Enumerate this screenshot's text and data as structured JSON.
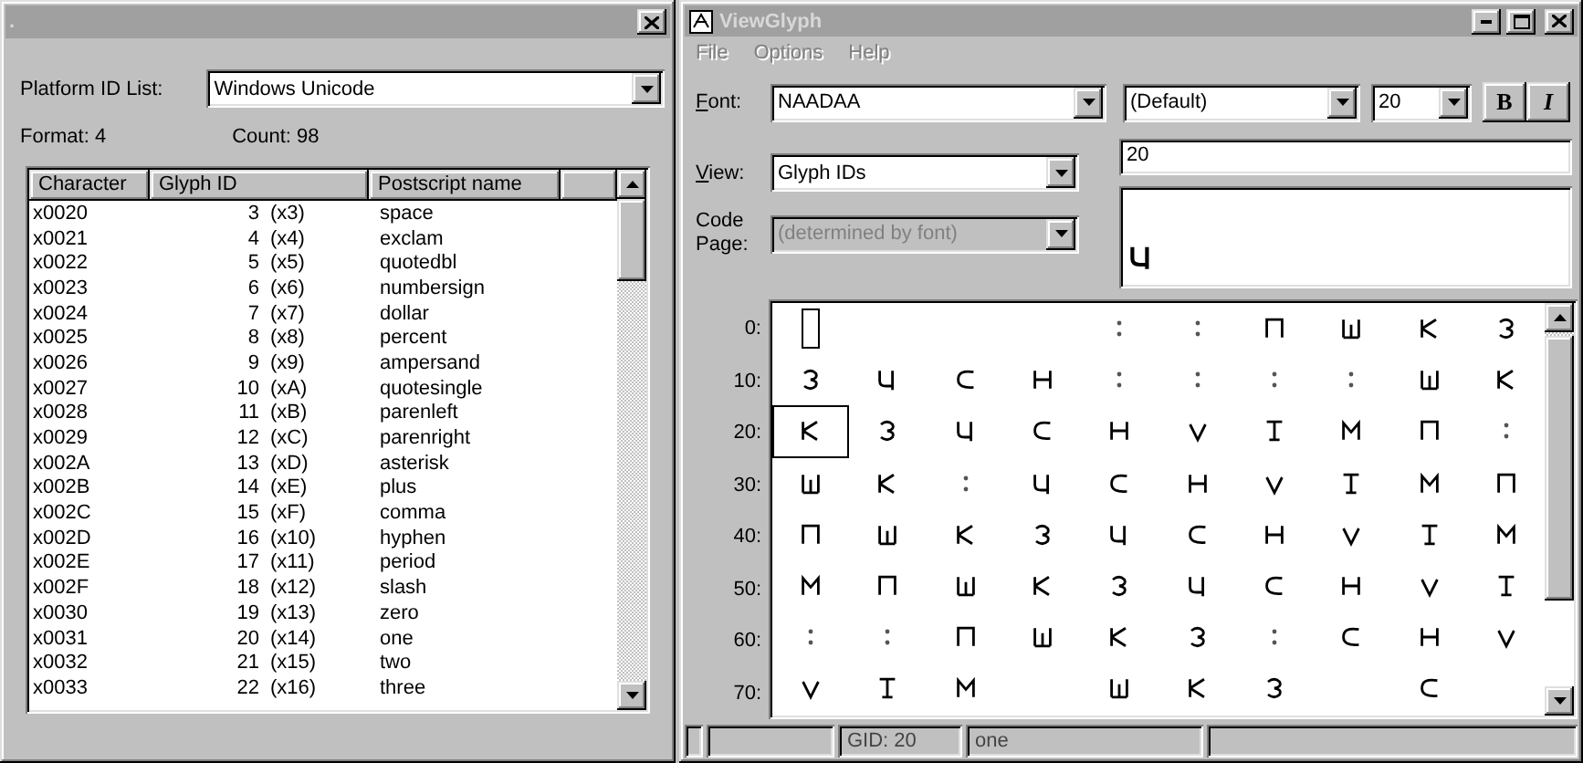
{
  "charmap_window": {
    "title": ".",
    "platform_label": "Platform ID List:",
    "platform_value": "Windows Unicode",
    "format": "Format: 4",
    "count": "Count: 98",
    "columns": [
      "Character",
      "Glyph ID",
      "Postscript name"
    ],
    "rows": [
      {
        "character": "x0020",
        "glyph_id": "3",
        "glyph_hex": "(x3)",
        "name": "space"
      },
      {
        "character": "x0021",
        "glyph_id": "4",
        "glyph_hex": "(x4)",
        "name": "exclam"
      },
      {
        "character": "x0022",
        "glyph_id": "5",
        "glyph_hex": "(x5)",
        "name": "quotedbl"
      },
      {
        "character": "x0023",
        "glyph_id": "6",
        "glyph_hex": "(x6)",
        "name": "numbersign"
      },
      {
        "character": "x0024",
        "glyph_id": "7",
        "glyph_hex": "(x7)",
        "name": "dollar"
      },
      {
        "character": "x0025",
        "glyph_id": "8",
        "glyph_hex": "(x8)",
        "name": "percent"
      },
      {
        "character": "x0026",
        "glyph_id": "9",
        "glyph_hex": "(x9)",
        "name": "ampersand"
      },
      {
        "character": "x0027",
        "glyph_id": "10",
        "glyph_hex": "(xA)",
        "name": "quotesingle"
      },
      {
        "character": "x0028",
        "glyph_id": "11",
        "glyph_hex": "(xB)",
        "name": "parenleft"
      },
      {
        "character": "x0029",
        "glyph_id": "12",
        "glyph_hex": "(xC)",
        "name": "parenright"
      },
      {
        "character": "x002A",
        "glyph_id": "13",
        "glyph_hex": "(xD)",
        "name": "asterisk"
      },
      {
        "character": "x002B",
        "glyph_id": "14",
        "glyph_hex": "(xE)",
        "name": "plus"
      },
      {
        "character": "x002C",
        "glyph_id": "15",
        "glyph_hex": "(xF)",
        "name": "comma"
      },
      {
        "character": "x002D",
        "glyph_id": "16",
        "glyph_hex": "(x10)",
        "name": "hyphen"
      },
      {
        "character": "x002E",
        "glyph_id": "17",
        "glyph_hex": "(x11)",
        "name": "period"
      },
      {
        "character": "x002F",
        "glyph_id": "18",
        "glyph_hex": "(x12)",
        "name": "slash"
      },
      {
        "character": "x0030",
        "glyph_id": "19",
        "glyph_hex": "(x13)",
        "name": "zero"
      },
      {
        "character": "x0031",
        "glyph_id": "20",
        "glyph_hex": "(x14)",
        "name": "one"
      },
      {
        "character": "x0032",
        "glyph_id": "21",
        "glyph_hex": "(x15)",
        "name": "two"
      },
      {
        "character": "x0033",
        "glyph_id": "22",
        "glyph_hex": "(x16)",
        "name": "three"
      }
    ]
  },
  "viewer_window": {
    "title": "ViewGlyph",
    "menu": [
      {
        "label": "File",
        "disabled": true
      },
      {
        "label": "Options",
        "disabled": true
      },
      {
        "label": "Help",
        "disabled": true
      }
    ],
    "font_label": "Font:",
    "font_value": "NAADAA",
    "style_value": "(Default)",
    "size_value": "20",
    "style_buttons": [
      {
        "label": "B",
        "kind": "bold"
      },
      {
        "label": "I",
        "kind": "italic"
      }
    ],
    "view_label": "View:",
    "view_value": "Glyph IDs",
    "code_page_label": "Code Page:",
    "code_page_value": "(determined by font)",
    "code_page_disabled": true,
    "preview_field": "20",
    "grid_rows": [
      {
        "label": "0:",
        "cells": [
          {
            "kind": "notdef",
            "selected": false
          },
          {
            "kind": "blank",
            "selected": false
          },
          {
            "kind": "blank",
            "selected": false
          },
          {
            "kind": "blank",
            "selected": false
          },
          {
            "kind": "mark",
            "selected": false
          },
          {
            "kind": "mark",
            "selected": false
          },
          {
            "kind": "glyph",
            "selected": false
          },
          {
            "kind": "glyph",
            "selected": false
          },
          {
            "kind": "glyph",
            "selected": false
          },
          {
            "kind": "glyph",
            "selected": false
          }
        ]
      },
      {
        "label": "10:",
        "cells": [
          {
            "kind": "glyph",
            "selected": false
          },
          {
            "kind": "glyph",
            "selected": false
          },
          {
            "kind": "glyph",
            "selected": false
          },
          {
            "kind": "glyph",
            "selected": false
          },
          {
            "kind": "mark",
            "selected": false
          },
          {
            "kind": "mark",
            "selected": false
          },
          {
            "kind": "mark",
            "selected": false
          },
          {
            "kind": "mark",
            "selected": false
          },
          {
            "kind": "glyph",
            "selected": false
          },
          {
            "kind": "glyph",
            "selected": false
          }
        ]
      },
      {
        "label": "20:",
        "cells": [
          {
            "kind": "glyph",
            "selected": true
          },
          {
            "kind": "glyph",
            "selected": false
          },
          {
            "kind": "glyph",
            "selected": false
          },
          {
            "kind": "glyph",
            "selected": false
          },
          {
            "kind": "glyph",
            "selected": false
          },
          {
            "kind": "glyph",
            "selected": false
          },
          {
            "kind": "glyph",
            "selected": false
          },
          {
            "kind": "glyph",
            "selected": false
          },
          {
            "kind": "glyph",
            "selected": false
          },
          {
            "kind": "mark",
            "selected": false
          }
        ]
      },
      {
        "label": "30:",
        "cells": [
          {
            "kind": "glyph",
            "selected": false
          },
          {
            "kind": "glyph",
            "selected": false
          },
          {
            "kind": "mark",
            "selected": false
          },
          {
            "kind": "glyph",
            "selected": false
          },
          {
            "kind": "glyph",
            "selected": false
          },
          {
            "kind": "glyph",
            "selected": false
          },
          {
            "kind": "glyph",
            "selected": false
          },
          {
            "kind": "glyph",
            "selected": false
          },
          {
            "kind": "glyph",
            "selected": false
          },
          {
            "kind": "glyph",
            "selected": false
          }
        ]
      },
      {
        "label": "40:",
        "cells": [
          {
            "kind": "glyph",
            "selected": false
          },
          {
            "kind": "glyph",
            "selected": false
          },
          {
            "kind": "glyph",
            "selected": false
          },
          {
            "kind": "glyph",
            "selected": false
          },
          {
            "kind": "glyph",
            "selected": false
          },
          {
            "kind": "glyph",
            "selected": false
          },
          {
            "kind": "glyph",
            "selected": false
          },
          {
            "kind": "glyph",
            "selected": false
          },
          {
            "kind": "glyph",
            "selected": false
          },
          {
            "kind": "glyph",
            "selected": false
          }
        ]
      },
      {
        "label": "50:",
        "cells": [
          {
            "kind": "glyph",
            "selected": false
          },
          {
            "kind": "glyph",
            "selected": false
          },
          {
            "kind": "glyph",
            "selected": false
          },
          {
            "kind": "glyph",
            "selected": false
          },
          {
            "kind": "glyph",
            "selected": false
          },
          {
            "kind": "glyph",
            "selected": false
          },
          {
            "kind": "glyph",
            "selected": false
          },
          {
            "kind": "glyph",
            "selected": false
          },
          {
            "kind": "glyph",
            "selected": false
          },
          {
            "kind": "glyph",
            "selected": false
          }
        ]
      },
      {
        "label": "60:",
        "cells": [
          {
            "kind": "mark",
            "selected": false
          },
          {
            "kind": "mark",
            "selected": false
          },
          {
            "kind": "glyph",
            "selected": false
          },
          {
            "kind": "glyph",
            "selected": false
          },
          {
            "kind": "glyph",
            "selected": false
          },
          {
            "kind": "glyph",
            "selected": false
          },
          {
            "kind": "mark",
            "selected": false
          },
          {
            "kind": "glyph",
            "selected": false
          },
          {
            "kind": "glyph",
            "selected": false
          },
          {
            "kind": "glyph",
            "selected": false
          }
        ]
      },
      {
        "label": "70:",
        "cells": [
          {
            "kind": "glyph",
            "selected": false
          },
          {
            "kind": "glyph",
            "selected": false
          },
          {
            "kind": "glyph",
            "selected": false
          },
          {
            "kind": "blank",
            "selected": false
          },
          {
            "kind": "glyph",
            "selected": false
          },
          {
            "kind": "glyph",
            "selected": false
          },
          {
            "kind": "glyph",
            "selected": false
          },
          {
            "kind": "blank",
            "selected": false
          },
          {
            "kind": "glyph",
            "selected": false
          },
          {
            "kind": "blank",
            "selected": false
          }
        ]
      }
    ],
    "status": [
      "GID: 20",
      "one"
    ]
  }
}
